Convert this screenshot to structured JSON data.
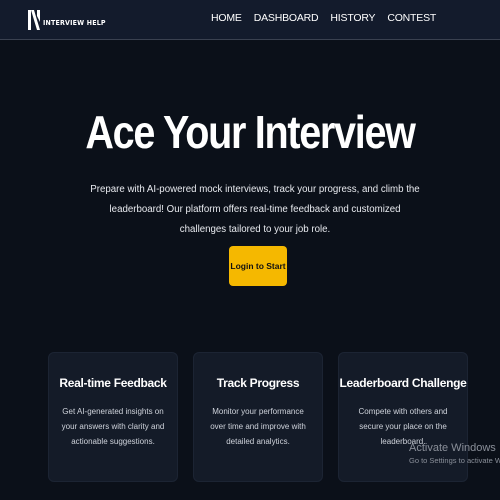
{
  "header": {
    "logo_text": "INTERVIEW HELP",
    "nav": [
      "HOME",
      "DASHBOARD",
      "HISTORY",
      "CONTEST"
    ]
  },
  "hero": {
    "title": "Ace Your Interview",
    "description": "Prepare with AI-powered mock interviews, track your progress, and climb the leaderboard! Our platform offers real-time feedback and customized challenges tailored to your job role.",
    "cta_label": "Login to Start"
  },
  "features": [
    {
      "title": "Real-time Feedback",
      "description": "Get AI-generated insights on your answers with clarity and actionable suggestions."
    },
    {
      "title": "Track Progress",
      "description": "Monitor your performance over time and improve with detailed analytics."
    },
    {
      "title": "Leaderboard Challenge",
      "description": "Compete with others and secure your place on the leaderboard."
    }
  ],
  "watermark": {
    "title": "Activate Windows",
    "subtitle": "Go to Settings to activate Windows."
  },
  "colors": {
    "background": "#0b1019",
    "header": "#131b2c",
    "accent": "#f5b800",
    "card": "#141b28"
  }
}
